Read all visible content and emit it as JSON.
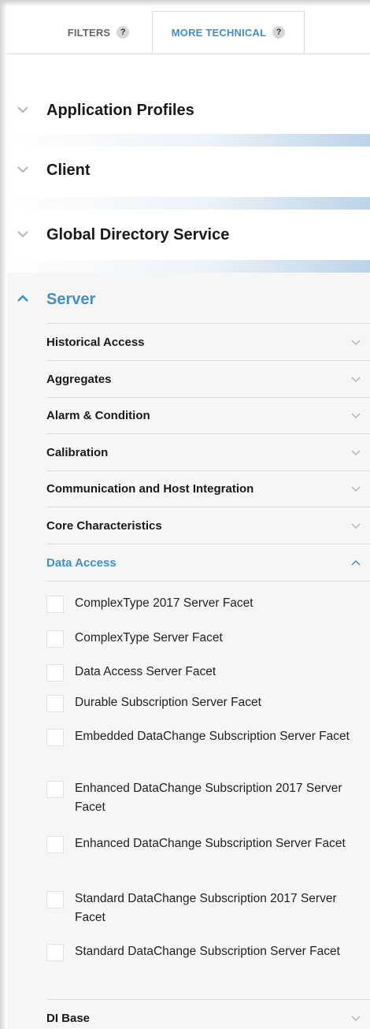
{
  "tabs": [
    {
      "label": "FILTERS",
      "help": "?",
      "active": false
    },
    {
      "label": "MORE TECHNICAL",
      "help": "?",
      "active": true
    }
  ],
  "sections": [
    {
      "title": "Application Profiles",
      "expanded": false,
      "icon": "chevron-down-icon"
    },
    {
      "title": "Client",
      "expanded": false,
      "icon": "chevron-down-icon"
    },
    {
      "title": "Global Directory Service",
      "expanded": false,
      "icon": "chevron-down-icon"
    },
    {
      "title": "Server",
      "expanded": true,
      "icon": "chevron-up-icon"
    }
  ],
  "server_subsections": [
    {
      "title": "Historical Access",
      "expanded": false
    },
    {
      "title": "Aggregates",
      "expanded": false
    },
    {
      "title": "Alarm & Condition",
      "expanded": false
    },
    {
      "title": "Calibration",
      "expanded": false
    },
    {
      "title": "Communication and Host Integration",
      "expanded": false
    },
    {
      "title": "Core Characteristics",
      "expanded": false
    },
    {
      "title": "Data Access",
      "expanded": true
    },
    {
      "title": "DI Base",
      "expanded": false
    }
  ],
  "data_access_options": [
    {
      "label": "ComplexType 2017 Server Facet",
      "checked": false
    },
    {
      "label": "ComplexType Server Facet",
      "checked": false
    },
    {
      "label": "Data Access Server Facet",
      "checked": false
    },
    {
      "label": "Durable Subscription Server Facet",
      "checked": false
    },
    {
      "label": "Embedded DataChange Subscription Server Facet",
      "checked": false
    },
    {
      "label": "Enhanced DataChange Subscription 2017 Server Facet",
      "checked": false
    },
    {
      "label": "Enhanced DataChange Subscription Server Facet",
      "checked": false
    },
    {
      "label": "Standard DataChange Subscription 2017 Server Facet",
      "checked": false
    },
    {
      "label": "Standard DataChange Subscription Server Facet",
      "checked": false
    }
  ],
  "colors": {
    "accent": "#3c8fd1",
    "text": "#1a1a1a",
    "muted": "#666666",
    "chevron": "#b5b5b5"
  }
}
